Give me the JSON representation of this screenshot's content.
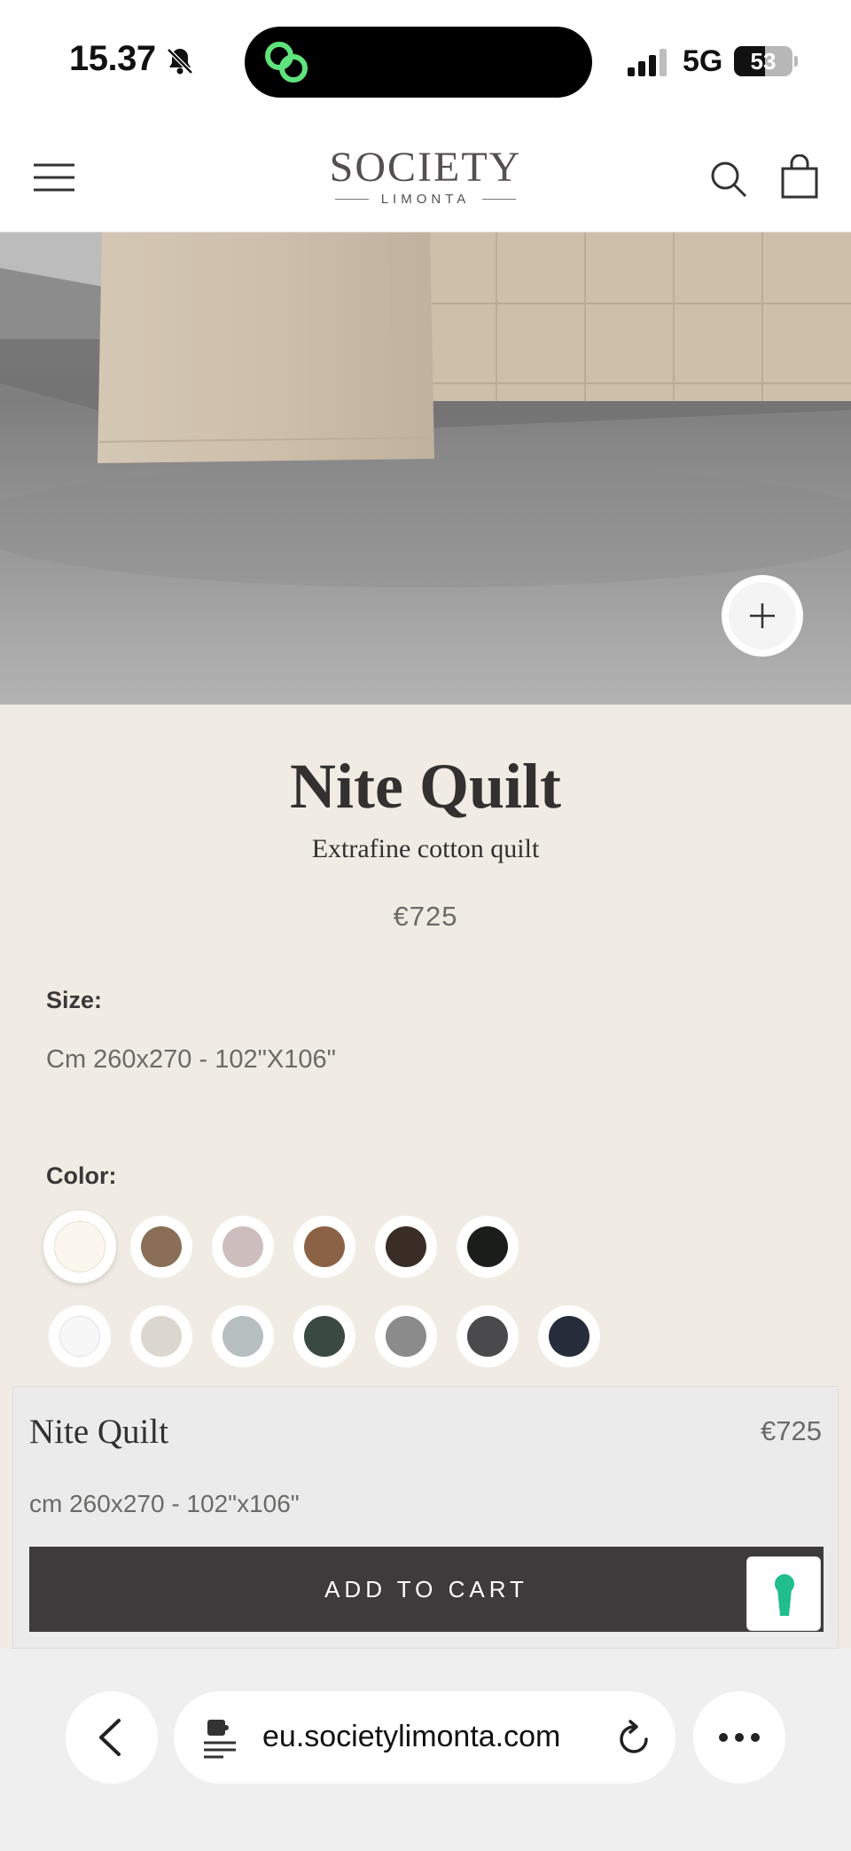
{
  "status_bar": {
    "time": "15.37",
    "network": "5G",
    "battery_percent": "53",
    "battery_level": 0.53
  },
  "header": {
    "logo_main": "SOCIETY",
    "logo_sub": "LIMONTA",
    "icons": [
      "menu-icon",
      "search-icon",
      "cart-icon"
    ]
  },
  "product": {
    "title": "Nite Quilt",
    "subtitle": "Extrafine cotton quilt",
    "price": "€725",
    "size_label": "Size:",
    "size_value": "Cm 260x270 - 102\"X106\"",
    "color_label": "Color:",
    "colors": [
      "#fbf6ee",
      "#8a6e55",
      "#cdbdbc",
      "#8b6245",
      "#3a2d25",
      "#1b1d1b",
      "#f7f7f7",
      "#dcd7ce",
      "#b6bec0",
      "#3b4a40",
      "#8b8b8b",
      "#4a4a4c",
      "#272c3a"
    ],
    "selected_color_index": 0
  },
  "sticky_bar": {
    "name": "Nite Quilt",
    "price": "€725",
    "size": "cm 260x270 - 102\"x106\"",
    "add_to_cart_label": "ADD TO CART",
    "chat_color": "#1fbe8c"
  },
  "browser": {
    "url": "eu.societylimonta.com"
  }
}
